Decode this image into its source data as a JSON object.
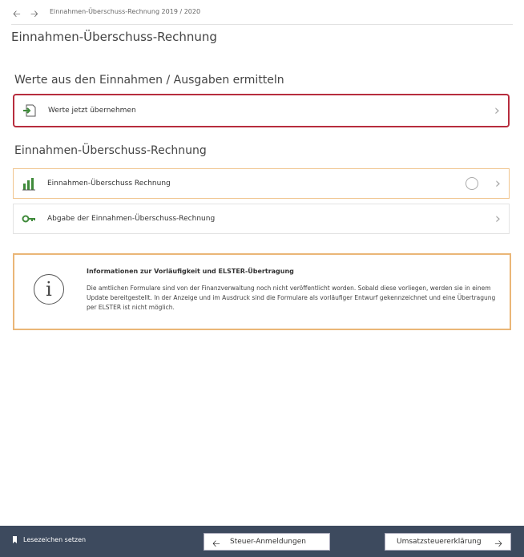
{
  "header": {
    "breadcrumb": "Einnahmen-Überschuss-Rechnung 2019 / 2020",
    "back_icon": "arrow-left-icon",
    "forward_icon": "arrow-right-icon"
  },
  "page_title": "Einnahmen-Überschuss-Rechnung",
  "section1": {
    "title": "Werte aus den Einnahmen / Ausgaben ermitteln",
    "items": [
      {
        "label": "Werte jetzt übernehmen",
        "icon": "import-document-icon"
      }
    ]
  },
  "section2": {
    "title": "Einnahmen-Überschuss-Rechnung",
    "items": [
      {
        "label": "Einnahmen-Überschuss Rechnung",
        "icon": "bar-chart-icon"
      },
      {
        "label": "Abgabe der Einnahmen-Überschuss-Rechnung",
        "icon": "send-key-icon"
      }
    ]
  },
  "info": {
    "icon": "info-icon",
    "title": "Informationen zur Vorläufigkeit und ELSTER-Übertragung",
    "text": "Die amtlichen Formulare sind von der Finanzverwaltung noch nicht veröffentlicht worden. Sobald diese vorliegen, werden sie in einem Update bereitgestellt. In der Anzeige und im Ausdruck sind die Formulare als vorläufiger Entwurf gekennzeichnet und eine Übertragung per ELSTER ist nicht möglich."
  },
  "footer": {
    "bookmark_label": "Lesezeichen setzen",
    "prev_label": "Steuer-Anmeldungen",
    "next_label": "Umsatzsteuererklärung"
  },
  "colors": {
    "highlight_border": "#b72d3e",
    "orange_border": "#eab677",
    "footer_bg": "#3d4a5e",
    "icon_green": "#3f8a3a"
  }
}
